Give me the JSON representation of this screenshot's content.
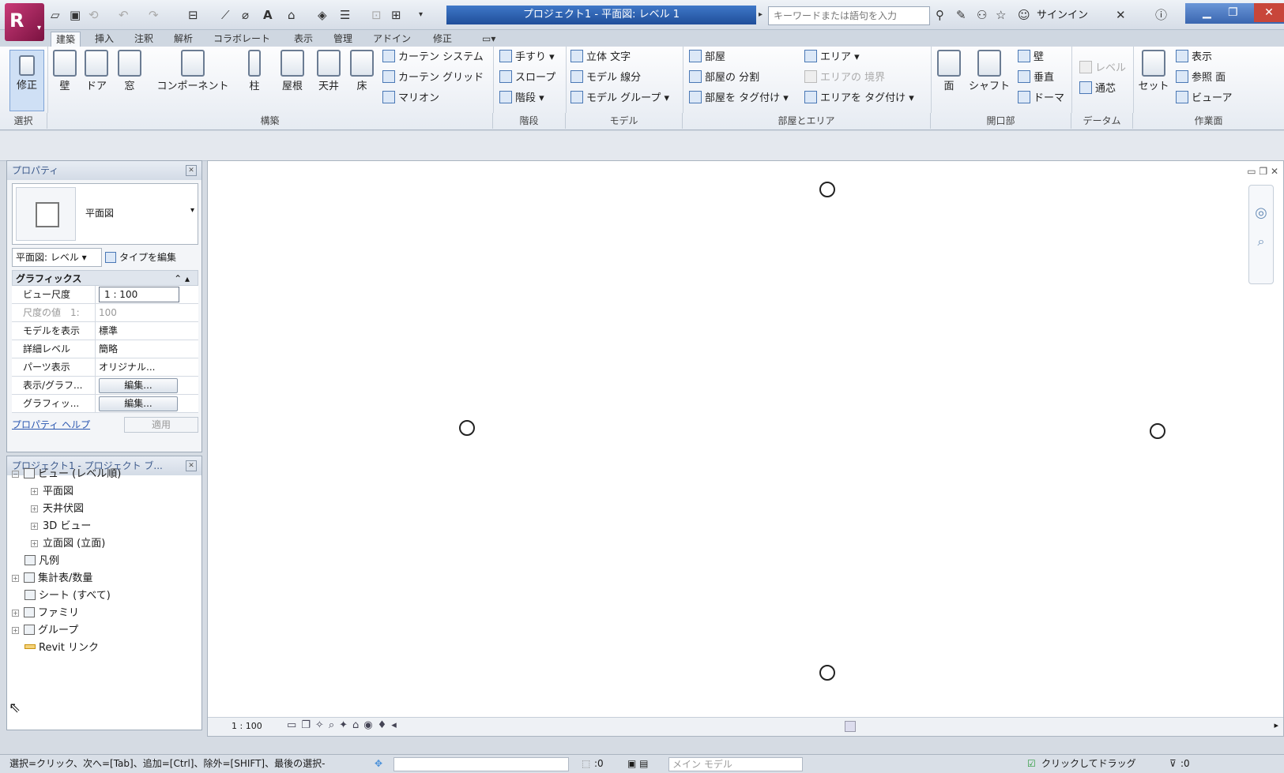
{
  "titlebar": {
    "app_menu": "R",
    "title": "プロジェクト1 - 平面図: レベル 1",
    "search_placeholder": "キーワードまたは語句を入力",
    "signin": "サインイン"
  },
  "tabs": [
    "建築",
    "挿入",
    "注釈",
    "解析",
    "コラボレート",
    "表示",
    "管理",
    "アドイン",
    "修正"
  ],
  "ribbon": {
    "select": {
      "label": "修正",
      "group": "選択"
    },
    "build": {
      "items": [
        "壁",
        "ドア",
        "窓",
        "コンポーネント",
        "柱",
        "屋根",
        "天井",
        "床"
      ],
      "small": [
        "カーテン システム",
        "カーテン グリッド",
        "マリオン"
      ],
      "group": "構築"
    },
    "circulation": {
      "small": [
        "手すり",
        "スロープ",
        "階段"
      ],
      "group": "階段"
    },
    "model": {
      "small": [
        "立体 文字",
        "モデル 線分",
        "モデル グループ"
      ],
      "group": "モデル"
    },
    "room": {
      "small": [
        "部屋",
        "部屋の 分割",
        "部屋を タグ付け",
        "エリア",
        "エリアの 境界",
        "エリアを タグ付け"
      ],
      "group": "部屋とエリア"
    },
    "opening": {
      "items": [
        "面",
        "シャフト"
      ],
      "small": [
        "壁",
        "垂直",
        "ドーマ"
      ],
      "group": "開口部"
    },
    "datum": {
      "small": [
        "レベル",
        "通芯"
      ],
      "group": "データム"
    },
    "workplane": {
      "items": [
        "セット"
      ],
      "small": [
        "表示",
        "参照 面",
        "ビューア"
      ],
      "group": "作業面"
    }
  },
  "properties": {
    "title": "プロパティ",
    "type_name": "平面図",
    "view_selector": "平面図: レベル",
    "edit_type": "タイプを編集",
    "category": "グラフィックス",
    "rows": [
      {
        "k": "ビュー尺度",
        "v": "1 : 100"
      },
      {
        "k": "尺度の値　1:",
        "v": "100"
      },
      {
        "k": "モデルを表示",
        "v": "標準"
      },
      {
        "k": "詳細レベル",
        "v": "簡略"
      },
      {
        "k": "パーツ表示",
        "v": "オリジナル..."
      },
      {
        "k": "表示/グラフ...",
        "v": "編集..."
      },
      {
        "k": "グラフィッ...",
        "v": "編集..."
      }
    ],
    "help": "プロパティ ヘルプ",
    "apply": "適用"
  },
  "browser": {
    "title": "プロジェクト1 - プロジェクト ブ...",
    "nodes": [
      "ビュー (レベル順)",
      "平面図",
      "天井伏図",
      "3D ビュー",
      "立面図 (立面)",
      "凡例",
      "集計表/数量",
      "シート (すべて)",
      "ファミリ",
      "グループ",
      "Revit リンク"
    ]
  },
  "view": {
    "scale": "1 : 100"
  },
  "status": {
    "hint": "選択=クリック、次へ=[Tab]、追加=[Ctrl]、除外=[SHIFT]、最後の選択-",
    "workset_count": ":0",
    "model": "メイン モデル",
    "click_drag": "クリックしてドラッグ",
    "filter_count": ":0"
  }
}
